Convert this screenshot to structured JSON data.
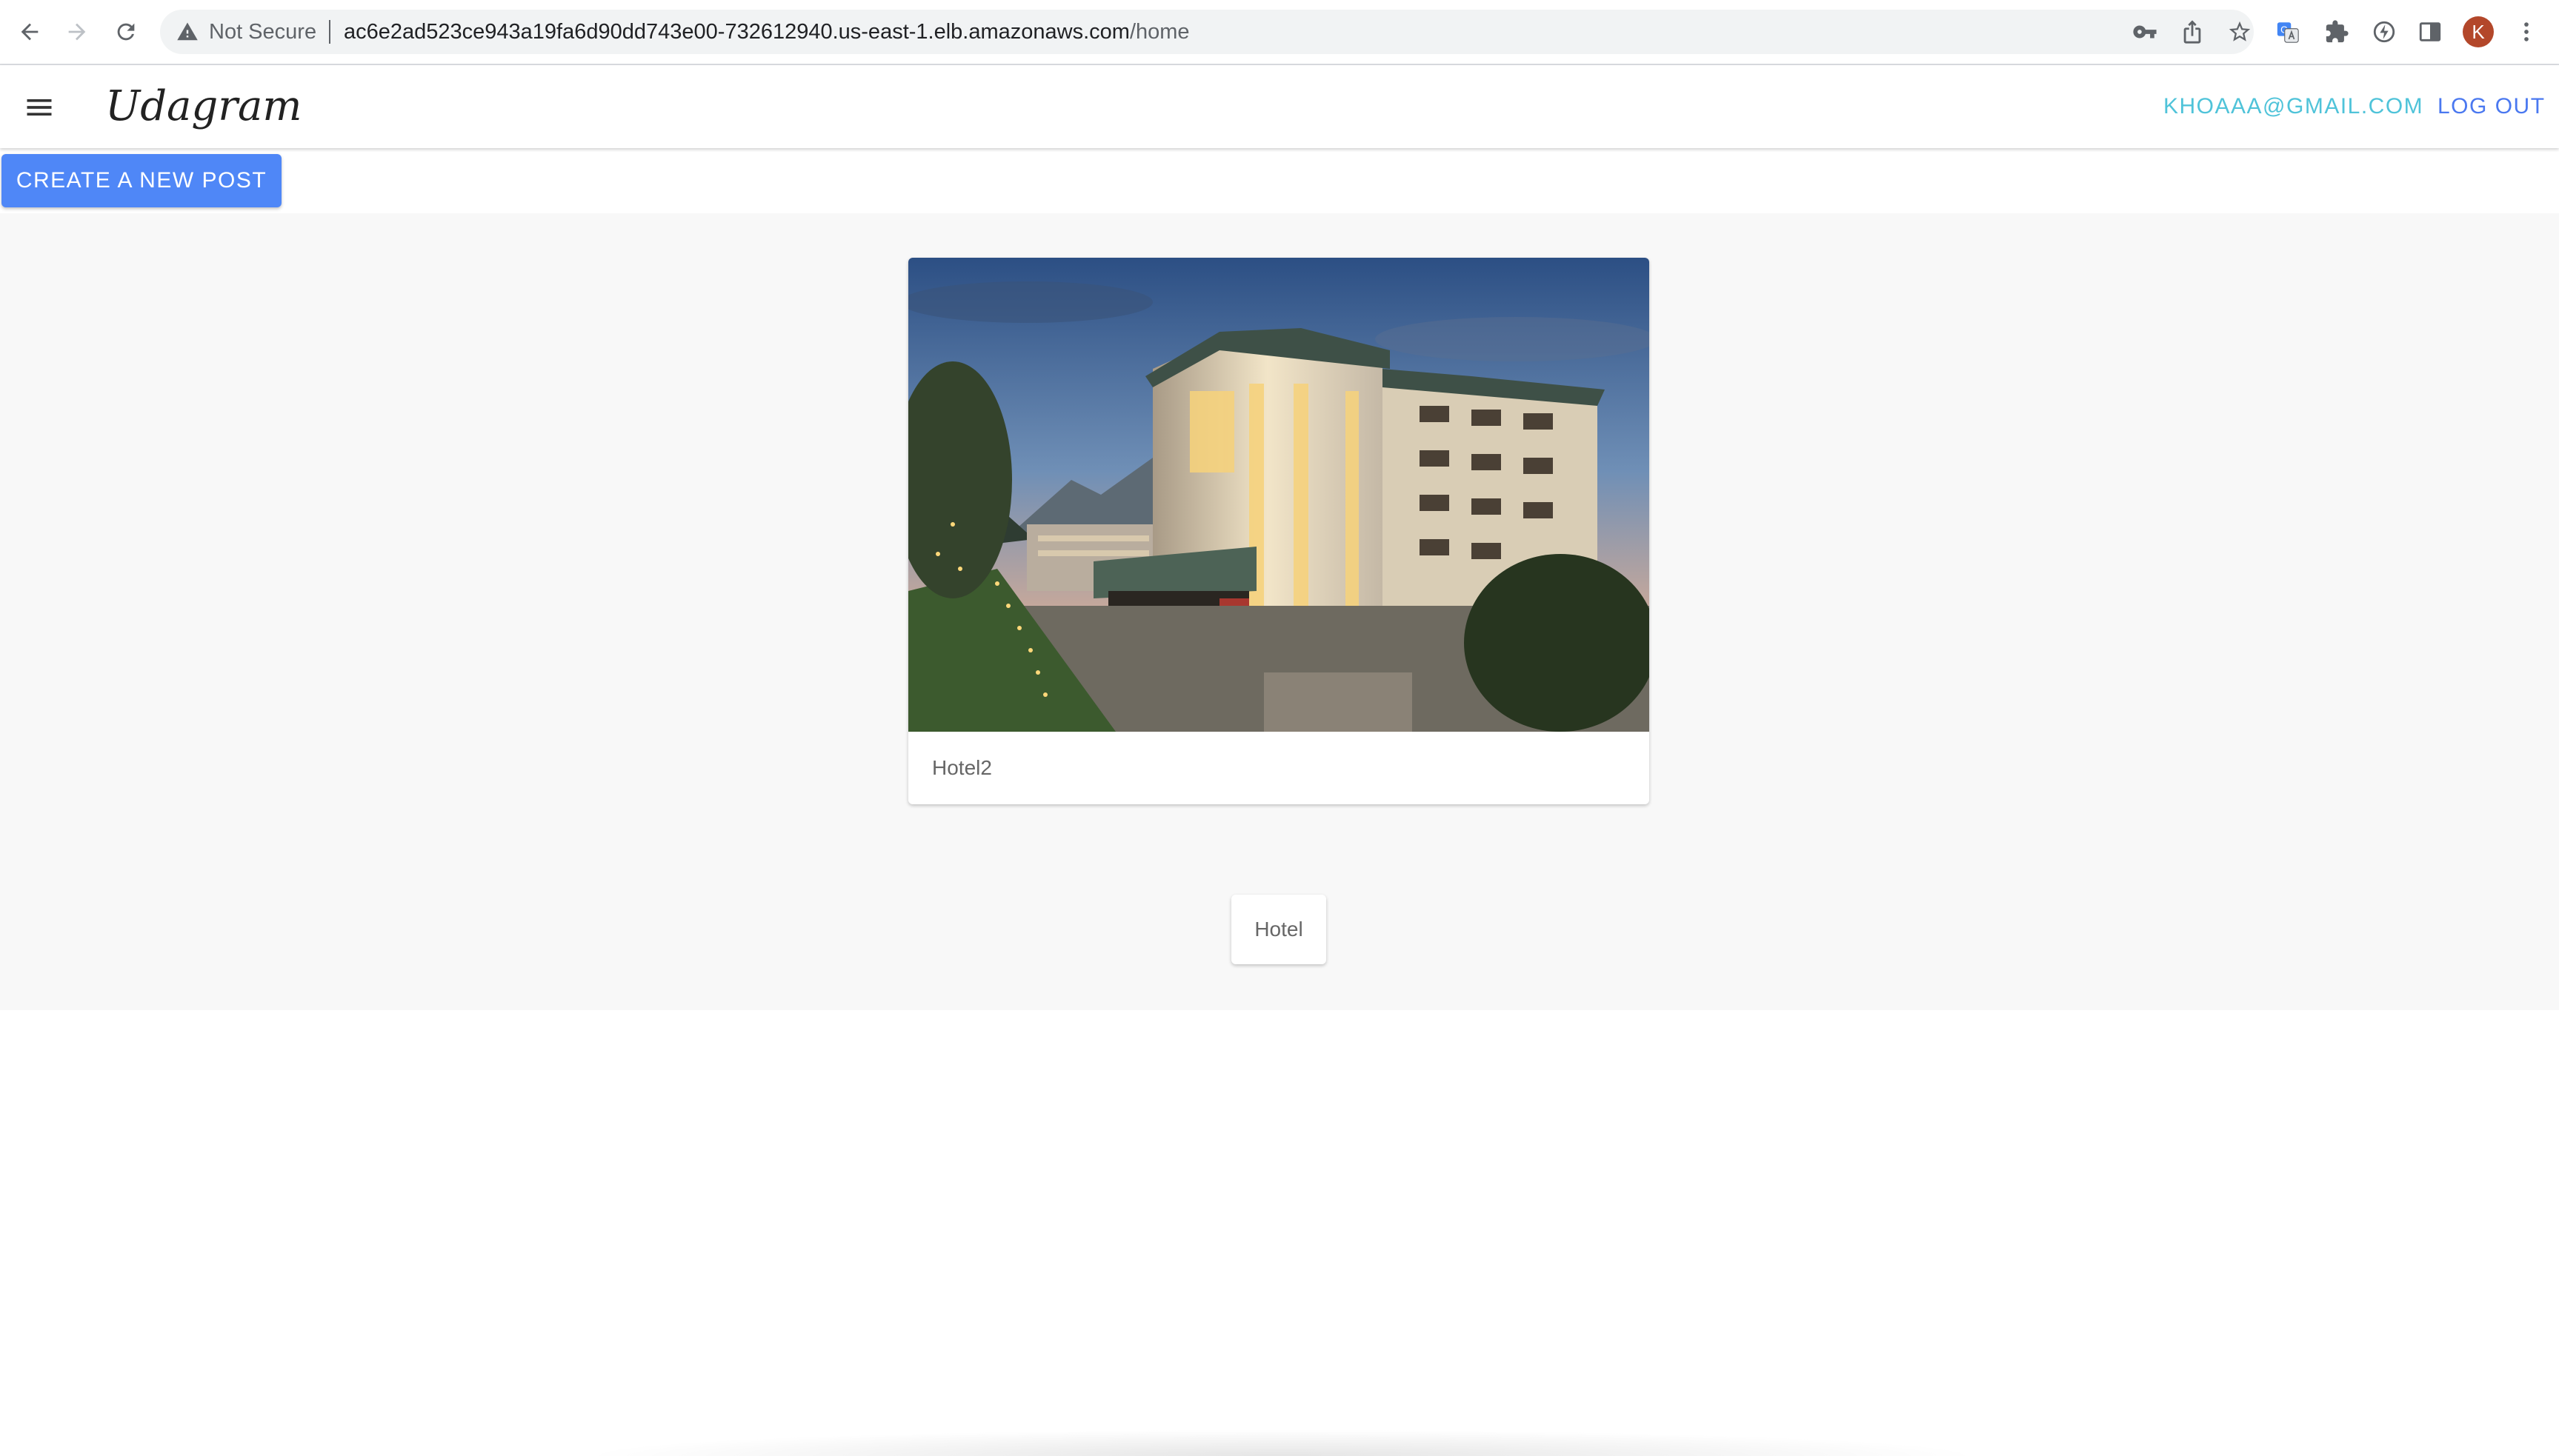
{
  "browser": {
    "security_label": "Not Secure",
    "url_host": "ac6e2ad523ce943a19fa6d90dd743e00-732612940.us-east-1.elb.amazonaws.com",
    "url_path": "/home",
    "profile_initial": "K"
  },
  "header": {
    "brand": "Udagram",
    "user_email": "KHOAAA@GMAIL.COM",
    "logout_label": "LOG OUT"
  },
  "actions": {
    "create_post_label": "CREATE A NEW POST"
  },
  "feed": {
    "posts": [
      {
        "caption": "Hotel2"
      },
      {
        "caption": "Hotel"
      }
    ]
  },
  "colors": {
    "primary": "#4f87f7",
    "email_accent": "#4fc3d9",
    "logout_accent": "#4a78f0",
    "content_bg": "#f8f8f8",
    "avatar": "#b3472a"
  }
}
